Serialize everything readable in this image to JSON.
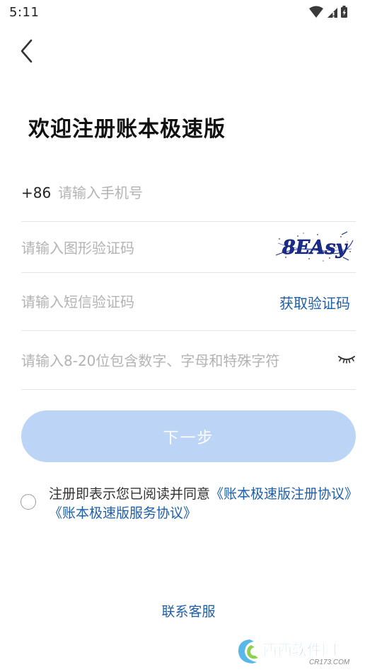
{
  "status_bar": {
    "time": "5:11",
    "icons": [
      "wifi-icon",
      "signal-icon",
      "battery-icon"
    ]
  },
  "nav": {
    "back_icon": "chevron-left-icon"
  },
  "title": "欢迎注册账本极速版",
  "form": {
    "country_code": "+86",
    "phone": {
      "value": "",
      "placeholder": "请输入手机号"
    },
    "captcha": {
      "value": "",
      "placeholder": "请输入图形验证码",
      "image_text": "8EAsy"
    },
    "sms": {
      "value": "",
      "placeholder": "请输入短信验证码",
      "get_code_label": "获取验证码"
    },
    "password": {
      "value": "",
      "placeholder": "请输入8-20位包含数字、字母和特殊字符",
      "toggle_icon": "eye-closed-icon"
    }
  },
  "next_button": "下一步",
  "agreement": {
    "checked": false,
    "prefix": "注册即表示您已阅读并同意",
    "register_link": "《账本极速版注册协议》",
    "service_link": "《账本极速版服务协议》"
  },
  "support_link": "联系客服",
  "watermark": {
    "brand": "西西软件园",
    "site": "CR173.COM"
  },
  "colors": {
    "accent": "#1f5fa8",
    "button_disabled": "#bcd4f5",
    "divider": "#e4e4e4",
    "placeholder": "#b3b3b3"
  }
}
